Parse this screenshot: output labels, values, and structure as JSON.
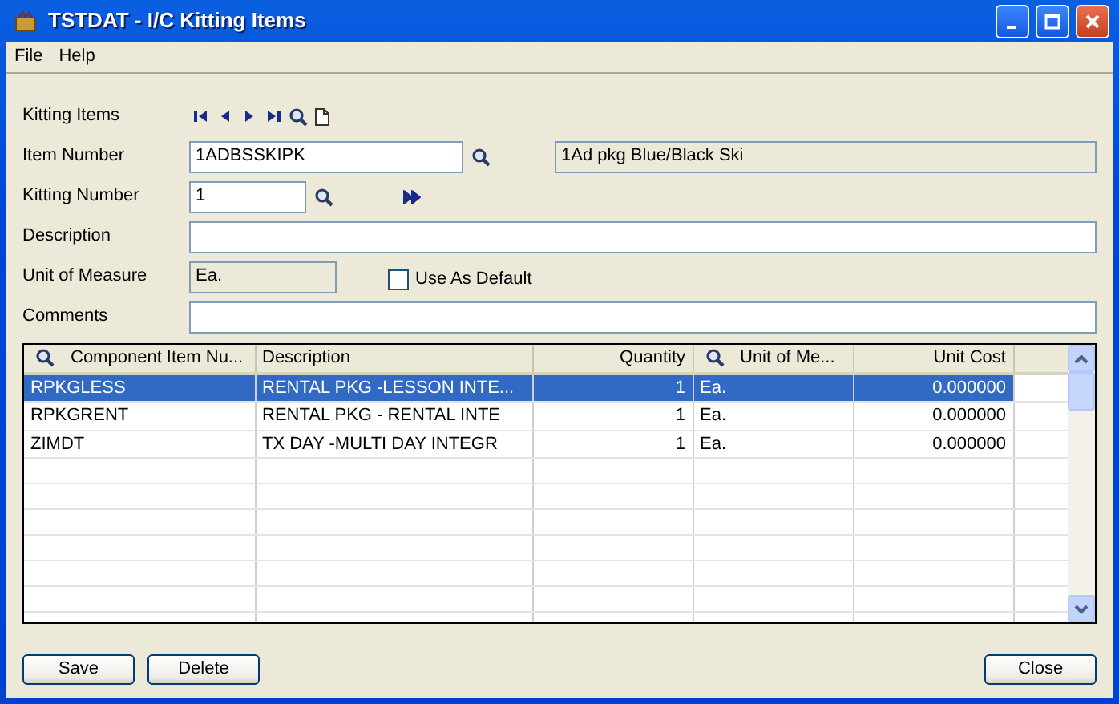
{
  "window": {
    "title": "TSTDAT - I/C Kitting Items"
  },
  "menu": [
    "File",
    "Help"
  ],
  "nav": {
    "label": "Kitting Items"
  },
  "item_number": {
    "label": "Item Number",
    "value": "1ADBSSKIPK",
    "description": "1Ad pkg Blue/Black Ski"
  },
  "kitting_number": {
    "label": "Kitting Number",
    "value": "1"
  },
  "description": {
    "label": "Description"
  },
  "unit_of_measure": {
    "label": "Unit of Measure",
    "value": "Ea.",
    "use_as_default": {
      "label": "Use As Default",
      "checked": false
    }
  },
  "comments": {
    "label": "Comments"
  },
  "grid": {
    "columns": [
      {
        "label": "Component Item Nu...",
        "lookup": true,
        "kind": "text"
      },
      {
        "label": "Description",
        "lookup": false,
        "kind": "text"
      },
      {
        "label": "Quantity",
        "lookup": false,
        "kind": "number"
      },
      {
        "label": "Unit of Me...",
        "lookup": true,
        "kind": "text"
      },
      {
        "label": "Unit Cost",
        "lookup": false,
        "kind": "number"
      }
    ],
    "rows": [
      {
        "cells": [
          "RPKGLESS",
          "RENTAL PKG -LESSON INTE...",
          "1",
          "Ea.",
          "0.000000"
        ],
        "selected": true
      },
      {
        "cells": [
          "RPKGRENT",
          "RENTAL  PKG - RENTAL INTE",
          "1",
          "Ea.",
          "0.000000"
        ],
        "selected": false
      },
      {
        "cells": [
          "ZIMDT",
          "TX DAY -MULTI DAY INTEGR",
          "1",
          "Ea.",
          "0.000000"
        ],
        "selected": false
      }
    ]
  },
  "buttons": {
    "left": [
      "Save",
      "Delete"
    ],
    "right": [
      "Close"
    ]
  }
}
